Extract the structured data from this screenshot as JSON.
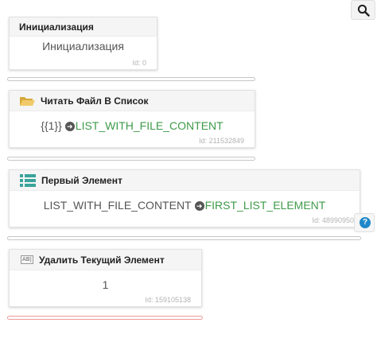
{
  "toolbar": {
    "search_icon": "search-icon",
    "help_icon": "help-icon",
    "help_glyph": "?"
  },
  "blocks": [
    {
      "title": "Инициализация",
      "body_text": "Инициализация",
      "id_label": "Id: 0"
    },
    {
      "title": "Читать Файл В Список",
      "icon": "folder-icon",
      "input": "{{1}}",
      "output": "LIST_WITH_FILE_CONTENT",
      "id_label": "Id: 211532849"
    },
    {
      "title": "Первый Элемент",
      "icon": "list-icon",
      "input": "LIST_WITH_FILE_CONTENT",
      "output": "FIRST_LIST_ELEMENT",
      "id_label": "Id: 489909507"
    },
    {
      "title": "Удалить Текущий Элемент",
      "icon": "text-field-icon",
      "icon_text": "AB|",
      "body_text": "1",
      "id_label": "Id: 159105138"
    }
  ],
  "colors": {
    "variable": "#3e9a4a",
    "folder": "#e8c25a",
    "list": "#3aa39a",
    "help": "#1e88c8",
    "active_connector": "#ef9a9a"
  }
}
